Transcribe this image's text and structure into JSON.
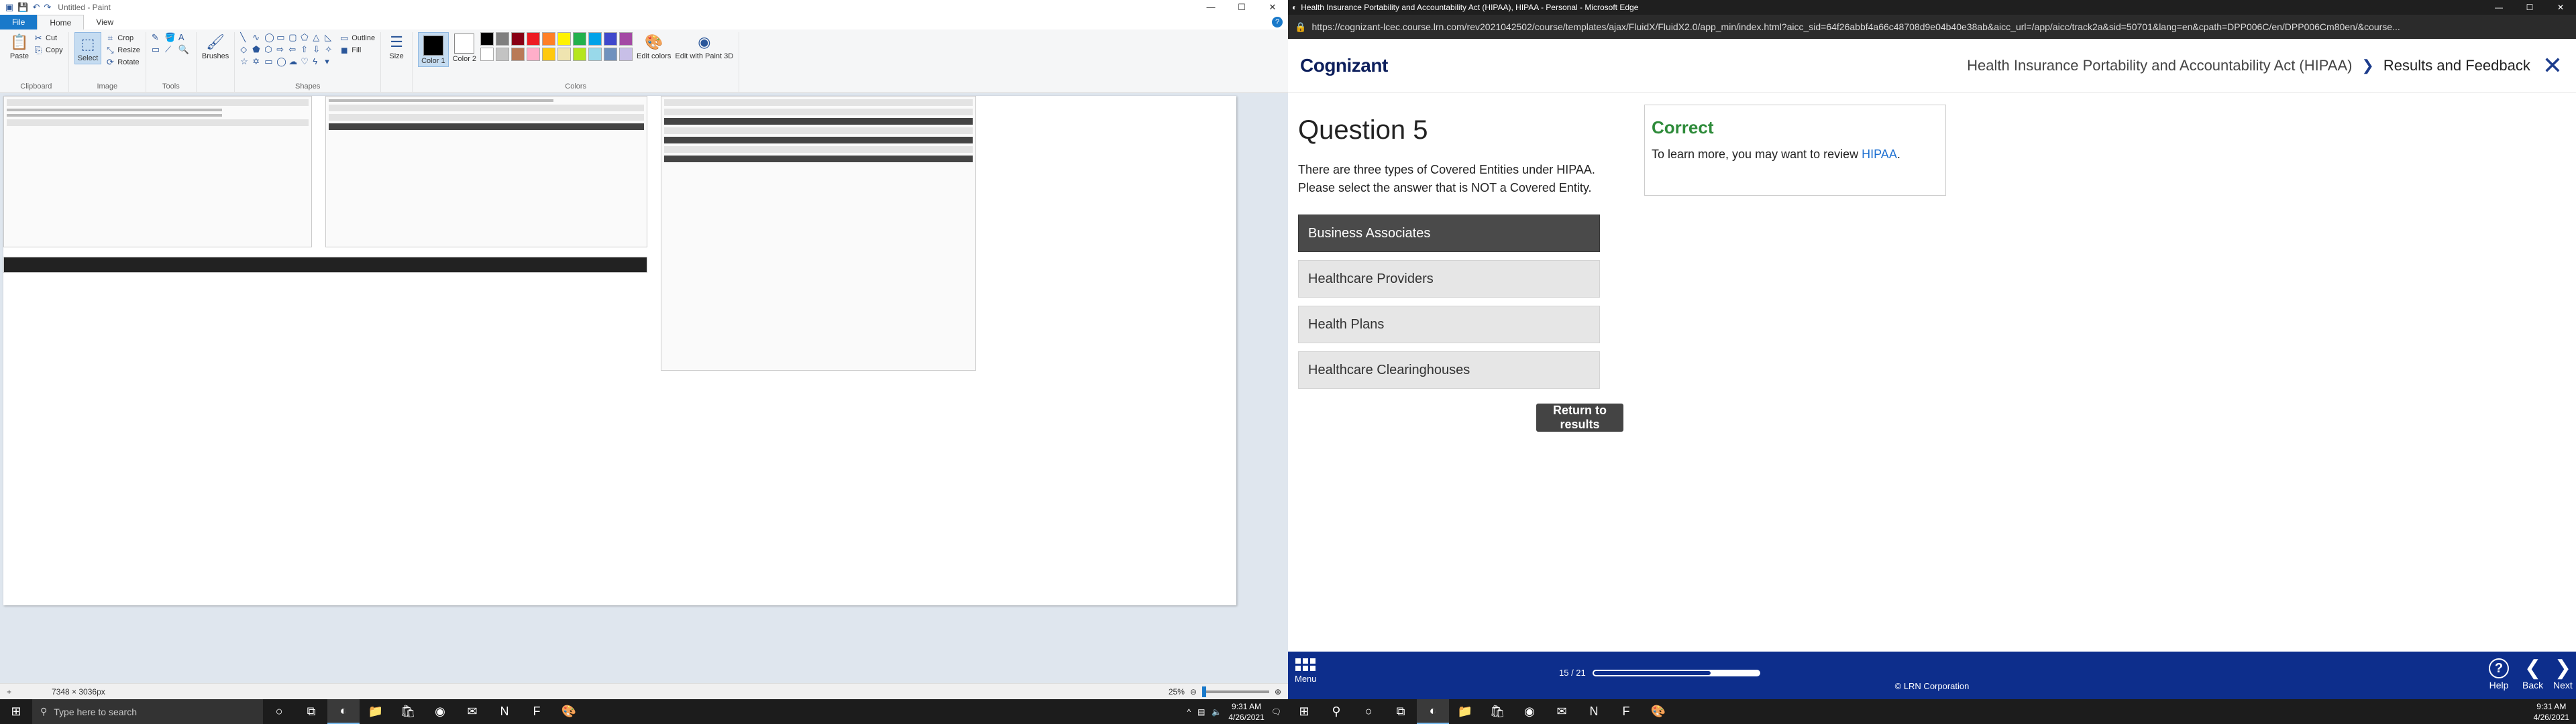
{
  "paint": {
    "title": "Untitled - Paint",
    "tabs": [
      "File",
      "Home",
      "View"
    ],
    "ribbon": {
      "clipboard": {
        "paste": "Paste",
        "cut": "Cut",
        "copy": "Copy",
        "label": "Clipboard"
      },
      "image": {
        "select": "Select",
        "crop": "Crop",
        "resize": "Resize",
        "rotate": "Rotate",
        "label": "Image"
      },
      "tools": {
        "label": "Tools"
      },
      "brushes": "Brushes",
      "shapes": {
        "outline": "Outline",
        "fill": "Fill",
        "label": "Shapes"
      },
      "size": "Size",
      "color1": "Color 1",
      "color2": "Color 2",
      "colors_label": "Colors",
      "edit_colors": "Edit colors",
      "edit_paint3d": "Edit with Paint 3D"
    },
    "palette": [
      "#000000",
      "#7f7f7f",
      "#880015",
      "#ed1c24",
      "#ff7f27",
      "#fff200",
      "#22b14c",
      "#00a2e8",
      "#3f48cc",
      "#a349a4",
      "#ffffff",
      "#c3c3c3",
      "#b97a57",
      "#ffaec9",
      "#ffc90e",
      "#efe4b0",
      "#b5e61d",
      "#99d9ea",
      "#7092be",
      "#c8bfe7"
    ],
    "status": {
      "dimensions": "7348 × 3036px",
      "zoom": "25%"
    }
  },
  "edge": {
    "title": "Health Insurance Portability and Accountability Act (HIPAA), HIPAA - Personal - Microsoft Edge",
    "url": "https://cognizant-lcec.course.lrn.com/rev2021042502/course/templates/ajax/FluidX/FluidX2.0/app_min/index.html?aicc_sid=64f26abbf4a66c48708d9e04b40e38ab&aicc_url=/app/aicc/track2a&sid=50701&lang=en&cpath=DPP006C/en/DPP006Cm80en/&course..."
  },
  "course": {
    "logo": "Cognizant",
    "breadcrumb": [
      "Health Insurance Portability and Accountability Act (HIPAA)",
      "Results and Feedback"
    ],
    "question_title": "Question 5",
    "question_text": "There are three types of Covered Entities under HIPAA. Please select the answer that is NOT a Covered Entity.",
    "answers": [
      {
        "label": "Business Associates",
        "selected": true
      },
      {
        "label": "Healthcare Providers",
        "selected": false
      },
      {
        "label": "Health Plans",
        "selected": false
      },
      {
        "label": "Healthcare Clearinghouses",
        "selected": false
      }
    ],
    "return_button": "Return to results",
    "feedback": {
      "title": "Correct",
      "text_before": "To learn more, you may want to review ",
      "link": "HIPAA",
      "text_after": "."
    },
    "footer": {
      "menu": "Menu",
      "progress_text": "15 / 21",
      "progress_fraction": 0.714,
      "copyright": "© LRN Corporation",
      "help": "Help",
      "back": "Back",
      "next": "Next"
    }
  },
  "taskbar": {
    "search_placeholder": "Type here to search",
    "time": "9:31 AM",
    "date": "4/26/2021"
  }
}
